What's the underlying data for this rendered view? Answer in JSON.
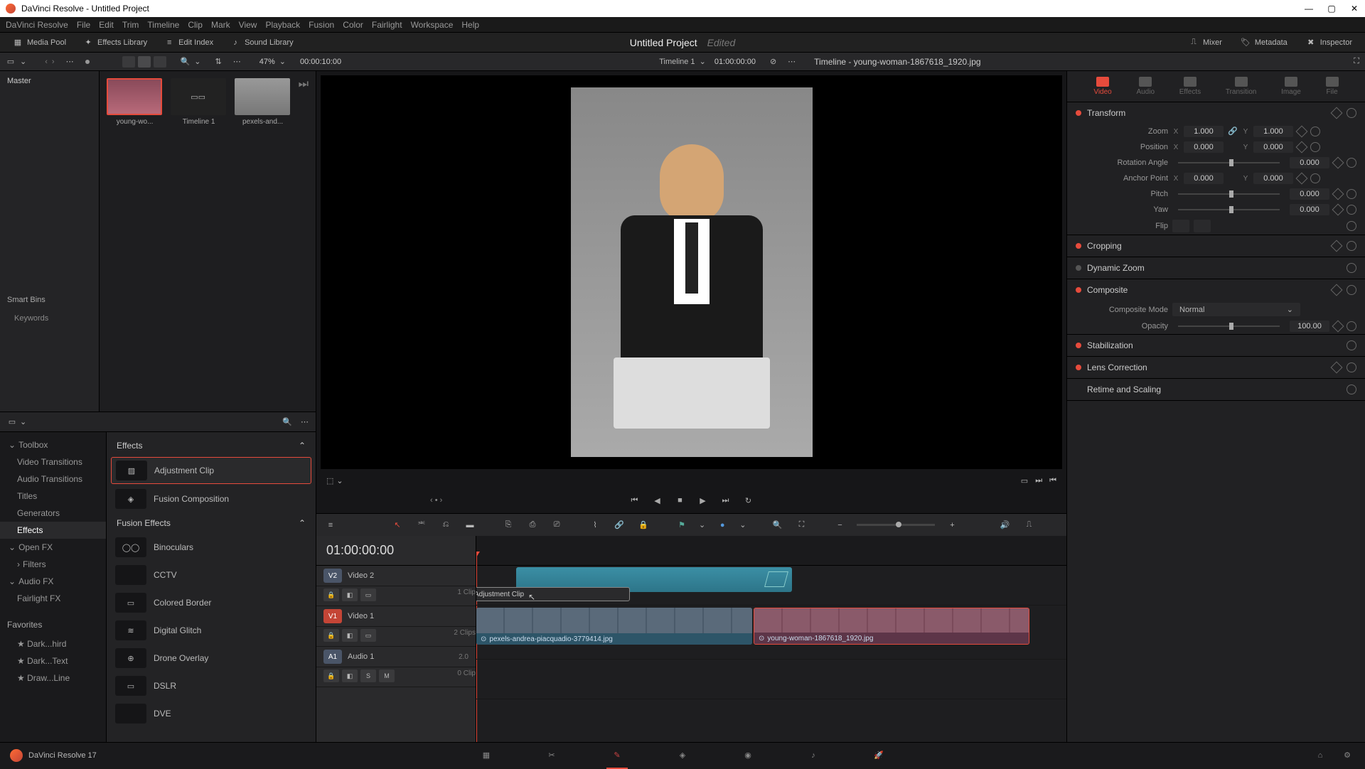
{
  "titlebar": {
    "text": "DaVinci Resolve - Untitled Project"
  },
  "menubar": [
    "DaVinci Resolve",
    "File",
    "Edit",
    "Trim",
    "Timeline",
    "Clip",
    "Mark",
    "View",
    "Playback",
    "Fusion",
    "Color",
    "Fairlight",
    "Workspace",
    "Help"
  ],
  "toolbar": {
    "media_pool": "Media Pool",
    "effects_library": "Effects Library",
    "edit_index": "Edit Index",
    "sound_library": "Sound Library",
    "project_name": "Untitled Project",
    "project_status": "Edited",
    "mixer": "Mixer",
    "metadata": "Metadata",
    "inspector": "Inspector"
  },
  "secondbar": {
    "zoom_pct": "47%",
    "tc_left": "00:00:10:00",
    "timeline_name": "Timeline 1",
    "tc_right": "01:00:00:00",
    "inspector_title": "Timeline - young-woman-1867618_1920.jpg"
  },
  "master": {
    "label": "Master",
    "smart_bins": "Smart Bins",
    "keywords": "Keywords"
  },
  "thumbs": [
    {
      "label": "young-wo..."
    },
    {
      "label": "Timeline 1"
    },
    {
      "label": "pexels-and..."
    }
  ],
  "effects_tree": {
    "toolbox": "Toolbox",
    "video_transitions": "Video Transitions",
    "audio_transitions": "Audio Transitions",
    "titles": "Titles",
    "generators": "Generators",
    "effects": "Effects",
    "fusion_effects": "Fusion Effects",
    "open_fx": "Open FX",
    "filters": "Filters",
    "audio_fx": "Audio FX",
    "fairlight_fx": "Fairlight FX",
    "favorites": "Favorites",
    "fav1": "Dark...hird",
    "fav2": "Dark...Text",
    "fav3": "Draw...Line"
  },
  "effects_list": {
    "cat1": "Effects",
    "adjustment_clip": "Adjustment Clip",
    "fusion_composition": "Fusion Composition",
    "cat2": "Fusion Effects",
    "binoculars": "Binoculars",
    "cctv": "CCTV",
    "colored_border": "Colored Border",
    "digital_glitch": "Digital Glitch",
    "drone_overlay": "Drone Overlay",
    "dslr": "DSLR",
    "dve": "DVE"
  },
  "timeline": {
    "big_tc": "01:00:00:00",
    "v2": "V2",
    "v2_label": "Video 2",
    "v1": "V1",
    "v1_label": "Video 1",
    "a1": "A1",
    "a1_label": "Audio 1",
    "a1_ch": "2.0",
    "clip_count_1": "1 Clip",
    "clip_count_2": "2 Clips",
    "clip_count_0": "0 Clip",
    "drag_label": "Adjustment Clip",
    "clip1_name": "pexels-andrea-piacquadio-3779414.jpg",
    "clip2_name": "young-woman-1867618_1920.jpg"
  },
  "inspector": {
    "tabs": [
      "Video",
      "Audio",
      "Effects",
      "Transition",
      "Image",
      "File"
    ],
    "transform": "Transform",
    "zoom": "Zoom",
    "zoom_x": "1.000",
    "zoom_y": "1.000",
    "position": "Position",
    "pos_x": "0.000",
    "pos_y": "0.000",
    "rotation": "Rotation Angle",
    "rot_v": "0.000",
    "anchor": "Anchor Point",
    "anc_x": "0.000",
    "anc_y": "0.000",
    "pitch": "Pitch",
    "pitch_v": "0.000",
    "yaw": "Yaw",
    "yaw_v": "0.000",
    "flip": "Flip",
    "cropping": "Cropping",
    "dynamic_zoom": "Dynamic Zoom",
    "composite": "Composite",
    "composite_mode": "Composite Mode",
    "composite_mode_v": "Normal",
    "opacity": "Opacity",
    "opacity_v": "100.00",
    "stabilization": "Stabilization",
    "lens_correction": "Lens Correction",
    "retime": "Retime and Scaling",
    "x": "X",
    "y": "Y"
  },
  "bottom": {
    "version": "DaVinci Resolve 17"
  },
  "track_btns": {
    "lock": "🔒",
    "auto": "◧",
    "s": "S",
    "m": "M"
  }
}
